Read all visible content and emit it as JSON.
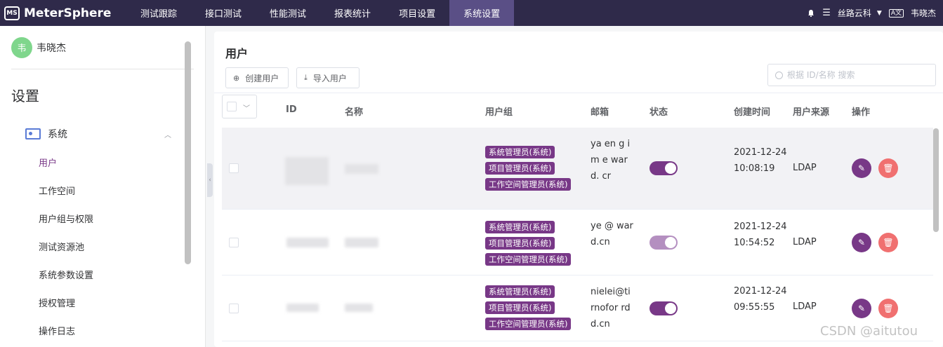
{
  "app": {
    "logo": "MeterSphere"
  },
  "nav": {
    "items": [
      {
        "label": "测试跟踪"
      },
      {
        "label": "接口测试"
      },
      {
        "label": "性能测试"
      },
      {
        "label": "报表统计"
      },
      {
        "label": "项目设置"
      },
      {
        "label": "系统设置"
      }
    ],
    "active": "系统设置"
  },
  "header_right": {
    "workspace": "丝路云科",
    "user": "韦晓杰",
    "icons": [
      "bell-icon",
      "list-icon",
      "language-icon"
    ]
  },
  "sidebar": {
    "avatar_char": "韦",
    "user_name": "韦晓杰",
    "title": "设置",
    "group_label": "系统",
    "items": [
      {
        "label": "用户"
      },
      {
        "label": "工作空间"
      },
      {
        "label": "用户组与权限"
      },
      {
        "label": "测试资源池"
      },
      {
        "label": "系统参数设置"
      },
      {
        "label": "授权管理"
      },
      {
        "label": "操作日志"
      }
    ],
    "active_item": "用户"
  },
  "page": {
    "title": "用户",
    "create_button": "创建用户",
    "import_button": "导入用户",
    "search_placeholder": "根据 ID/名称 搜索"
  },
  "table": {
    "columns": [
      "ID",
      "名称",
      "用户组",
      "邮箱",
      "状态",
      "创建时间",
      "用户来源",
      "操作"
    ],
    "rows": [
      {
        "groups": [
          "系统管理员(系统)",
          "项目管理员(系统)",
          "工作空间管理员(系统)"
        ],
        "email": "ya        en g        im e        ward. cr",
        "status_on": true,
        "created": "2021-12-24 10:08:19",
        "source": "LDAP"
      },
      {
        "groups": [
          "系统管理员(系统)",
          "项目管理员(系统)",
          "工作空间管理员(系统)"
        ],
        "email": "        ye @        ward.cn",
        "status_on": true,
        "created": "2021-12-24 10:54:52",
        "source": "LDAP"
      },
      {
        "groups": [
          "系统管理员(系统)",
          "项目管理员(系统)",
          "工作空间管理员(系统)"
        ],
        "email": "nielei@ti rnofor   rd d.cn",
        "status_on": true,
        "created": "2021-12-24 09:55:55",
        "source": "LDAP"
      }
    ]
  },
  "watermark": "CSDN @aitutou",
  "colors": {
    "primary": "#783887",
    "topbar": "#2f2a4a",
    "danger": "#f07070"
  }
}
